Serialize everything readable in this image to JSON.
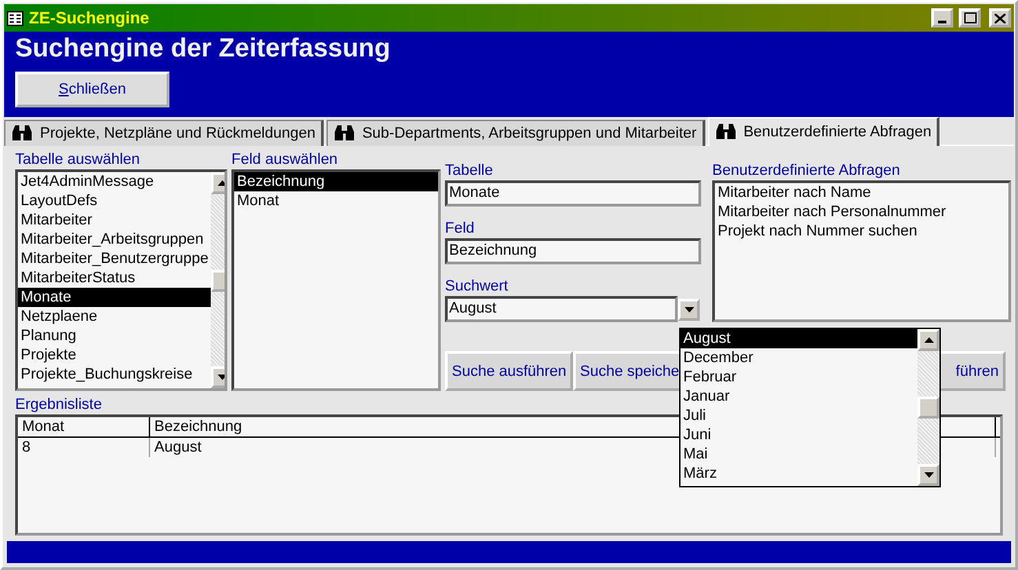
{
  "window": {
    "title": "ZE-Suchengine"
  },
  "header": {
    "title": "Suchengine der Zeiterfassung",
    "close_button": "Schließen"
  },
  "tabs": [
    {
      "label": "Projekte, Netzpläne und Rückmeldungen",
      "selected": false
    },
    {
      "label": "Sub-Departments, Arbeitsgruppen und Mitarbeiter",
      "selected": false
    },
    {
      "label": "Benutzerdefinierte Abfragen",
      "selected": true
    }
  ],
  "table_picker": {
    "label": "Tabelle auswählen",
    "items": [
      {
        "label": "Jet4AdminMessage",
        "selected": false
      },
      {
        "label": "LayoutDefs",
        "selected": false
      },
      {
        "label": "Mitarbeiter",
        "selected": false
      },
      {
        "label": "Mitarbeiter_Arbeitsgruppen",
        "selected": false
      },
      {
        "label": "Mitarbeiter_Benutzergruppe",
        "selected": false
      },
      {
        "label": "MitarbeiterStatus",
        "selected": false
      },
      {
        "label": "Monate",
        "selected": true
      },
      {
        "label": "Netzplaene",
        "selected": false
      },
      {
        "label": "Planung",
        "selected": false
      },
      {
        "label": "Projekte",
        "selected": false
      },
      {
        "label": "Projekte_Buchungskreise",
        "selected": false
      }
    ]
  },
  "field_picker": {
    "label": "Feld auswählen",
    "items": [
      {
        "label": "Bezeichnung",
        "selected": true
      },
      {
        "label": "Monat",
        "selected": false
      }
    ]
  },
  "table_field": {
    "label": "Tabelle",
    "value": "Monate"
  },
  "field_field": {
    "label": "Feld",
    "value": "Bezeichnung"
  },
  "search_value": {
    "label": "Suchwert",
    "value": "August",
    "options": [
      {
        "label": "August",
        "selected": true
      },
      {
        "label": "December",
        "selected": false
      },
      {
        "label": "Februar",
        "selected": false
      },
      {
        "label": "Januar",
        "selected": false
      },
      {
        "label": "Juli",
        "selected": false
      },
      {
        "label": "Juni",
        "selected": false
      },
      {
        "label": "Mai",
        "selected": false
      },
      {
        "label": "März",
        "selected": false
      }
    ]
  },
  "custom_queries": {
    "label": "Benutzerdefinierte Abfragen",
    "items": [
      "Mitarbeiter nach Name",
      "Mitarbeiter nach Personalnummer",
      "Projekt nach Nummer suchen"
    ]
  },
  "buttons": [
    "Suche ausführen",
    "Suche speiche",
    "führen"
  ],
  "results": {
    "label": "Ergebnisliste",
    "columns": [
      "Monat",
      "Bezeichnung"
    ],
    "rows": [
      [
        "8",
        "August"
      ]
    ]
  }
}
